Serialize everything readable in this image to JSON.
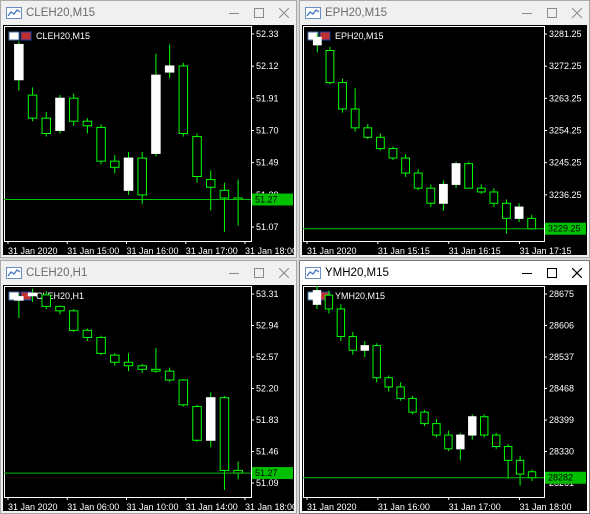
{
  "windows": [
    {
      "title": "CLEH20,M15",
      "active": false,
      "chart_label": "CLEH20,M15",
      "price_ticks": [
        "52.33",
        "52.12",
        "51.91",
        "51.70",
        "51.49",
        "51.28",
        "51.07"
      ],
      "current_price": "51.27",
      "time_ticks": [
        "31 Jan 2020",
        "31 Jan 15:00",
        "31 Jan 16:00",
        "31 Jan 17:00",
        "31 Jan 18:00"
      ]
    },
    {
      "title": "EPH20,M15",
      "active": false,
      "chart_label": "EPH20,M15",
      "price_ticks": [
        "3281.25",
        "3272.25",
        "3263.25",
        "3254.25",
        "3245.25",
        "3236.25",
        "3227.25"
      ],
      "current_price": "3229.25",
      "time_ticks": [
        "31 Jan 2020",
        "31 Jan 15:15",
        "31 Jan 16:15",
        "31 Jan 17:15"
      ]
    },
    {
      "title": "CLEH20,H1",
      "active": false,
      "chart_label": "CLEH20,H1",
      "price_ticks": [
        "53.31",
        "52.94",
        "52.57",
        "52.20",
        "51.83",
        "51.46",
        "51.09"
      ],
      "current_price": "51.27",
      "time_ticks": [
        "31 Jan 2020",
        "31 Jan 06:00",
        "31 Jan 10:00",
        "31 Jan 14:00",
        "31 Jan 18:00"
      ]
    },
    {
      "title": "YMH20,M15",
      "active": true,
      "chart_label": "YMH20,M15",
      "price_ticks": [
        "28675",
        "28606",
        "28537",
        "28468",
        "28399",
        "28330",
        "28261"
      ],
      "current_price": "28282",
      "time_ticks": [
        "31 Jan 2020",
        "31 Jan 16:00",
        "31 Jan 17:00",
        "31 Jan 18:00"
      ]
    }
  ],
  "colors": {
    "chart_bg": "#000000",
    "candle_up": "#ffffff",
    "candle_down": "#ffffff",
    "wick": "#00ff00",
    "axis_text": "#ffffff",
    "price_line": "#00c000",
    "price_tag": "#00c000",
    "frame": "#ffffff"
  },
  "chart_data": [
    {
      "type": "candlestick",
      "symbol": "CLEH20,M15",
      "ylim": [
        51.0,
        52.4
      ],
      "candles": [
        {
          "o": 52.05,
          "h": 52.3,
          "l": 51.98,
          "c": 52.28
        },
        {
          "o": 51.95,
          "h": 52.0,
          "l": 51.78,
          "c": 51.8
        },
        {
          "o": 51.8,
          "h": 51.84,
          "l": 51.68,
          "c": 51.7
        },
        {
          "o": 51.72,
          "h": 51.95,
          "l": 51.7,
          "c": 51.93
        },
        {
          "o": 51.93,
          "h": 51.96,
          "l": 51.75,
          "c": 51.78
        },
        {
          "o": 51.78,
          "h": 51.8,
          "l": 51.7,
          "c": 51.75
        },
        {
          "o": 51.74,
          "h": 51.76,
          "l": 51.5,
          "c": 51.52
        },
        {
          "o": 51.52,
          "h": 51.56,
          "l": 51.44,
          "c": 51.48
        },
        {
          "o": 51.33,
          "h": 51.58,
          "l": 51.3,
          "c": 51.54
        },
        {
          "o": 51.54,
          "h": 51.58,
          "l": 51.24,
          "c": 51.3
        },
        {
          "o": 51.57,
          "h": 52.22,
          "l": 51.55,
          "c": 52.08
        },
        {
          "o": 52.1,
          "h": 52.28,
          "l": 52.06,
          "c": 52.14
        },
        {
          "o": 52.14,
          "h": 52.16,
          "l": 51.68,
          "c": 51.7
        },
        {
          "o": 51.68,
          "h": 51.7,
          "l": 51.38,
          "c": 51.42
        },
        {
          "o": 51.4,
          "h": 51.46,
          "l": 51.2,
          "c": 51.35
        },
        {
          "o": 51.33,
          "h": 51.38,
          "l": 51.06,
          "c": 51.28
        },
        {
          "o": 51.28,
          "h": 51.4,
          "l": 51.1,
          "c": 51.27
        }
      ],
      "current_price": 51.27
    },
    {
      "type": "candlestick",
      "symbol": "EPH20,M15",
      "ylim": [
        3226.0,
        3283.0
      ],
      "candles": [
        {
          "o": 3278.0,
          "h": 3281.0,
          "l": 3276.0,
          "c": 3280.0
        },
        {
          "o": 3276.5,
          "h": 3277.5,
          "l": 3267.5,
          "c": 3268.0
        },
        {
          "o": 3268.0,
          "h": 3269.0,
          "l": 3260.0,
          "c": 3261.0
        },
        {
          "o": 3261.0,
          "h": 3266.5,
          "l": 3255.0,
          "c": 3256.0
        },
        {
          "o": 3256.0,
          "h": 3257.0,
          "l": 3253.0,
          "c": 3253.5
        },
        {
          "o": 3253.5,
          "h": 3254.5,
          "l": 3250.0,
          "c": 3250.5
        },
        {
          "o": 3250.5,
          "h": 3251.0,
          "l": 3247.5,
          "c": 3248.0
        },
        {
          "o": 3248.0,
          "h": 3249.0,
          "l": 3243.0,
          "c": 3244.0
        },
        {
          "o": 3244.0,
          "h": 3245.0,
          "l": 3239.5,
          "c": 3240.0
        },
        {
          "o": 3240.0,
          "h": 3241.0,
          "l": 3235.0,
          "c": 3236.0
        },
        {
          "o": 3236.0,
          "h": 3242.0,
          "l": 3234.0,
          "c": 3241.0
        },
        {
          "o": 3241.0,
          "h": 3247.0,
          "l": 3240.0,
          "c": 3246.5
        },
        {
          "o": 3246.5,
          "h": 3247.0,
          "l": 3240.0,
          "c": 3240.0
        },
        {
          "o": 3240.0,
          "h": 3241.0,
          "l": 3238.5,
          "c": 3239.0
        },
        {
          "o": 3239.0,
          "h": 3240.0,
          "l": 3235.0,
          "c": 3236.0
        },
        {
          "o": 3236.0,
          "h": 3237.0,
          "l": 3228.0,
          "c": 3232.0
        },
        {
          "o": 3232.0,
          "h": 3236.0,
          "l": 3231.0,
          "c": 3235.0
        },
        {
          "o": 3232.0,
          "h": 3233.0,
          "l": 3229.0,
          "c": 3229.25
        }
      ],
      "current_price": 3229.25
    },
    {
      "type": "candlestick",
      "symbol": "CLEH20,H1",
      "ylim": [
        51.0,
        53.38
      ],
      "candles": [
        {
          "o": 53.22,
          "h": 53.28,
          "l": 53.02,
          "c": 53.26
        },
        {
          "o": 53.27,
          "h": 53.35,
          "l": 53.2,
          "c": 53.3
        },
        {
          "o": 53.28,
          "h": 53.32,
          "l": 53.12,
          "c": 53.15
        },
        {
          "o": 53.15,
          "h": 53.16,
          "l": 53.06,
          "c": 53.1
        },
        {
          "o": 53.1,
          "h": 53.12,
          "l": 52.86,
          "c": 52.88
        },
        {
          "o": 52.88,
          "h": 52.9,
          "l": 52.76,
          "c": 52.8
        },
        {
          "o": 52.8,
          "h": 52.82,
          "l": 52.6,
          "c": 52.62
        },
        {
          "o": 52.6,
          "h": 52.62,
          "l": 52.48,
          "c": 52.52
        },
        {
          "o": 52.52,
          "h": 52.62,
          "l": 52.42,
          "c": 52.48
        },
        {
          "o": 52.48,
          "h": 52.5,
          "l": 52.4,
          "c": 52.44
        },
        {
          "o": 52.44,
          "h": 52.68,
          "l": 52.4,
          "c": 52.42
        },
        {
          "o": 52.42,
          "h": 52.46,
          "l": 52.3,
          "c": 52.32
        },
        {
          "o": 52.32,
          "h": 52.33,
          "l": 52.02,
          "c": 52.04
        },
        {
          "o": 52.02,
          "h": 52.04,
          "l": 51.62,
          "c": 51.64
        },
        {
          "o": 51.64,
          "h": 52.18,
          "l": 51.56,
          "c": 52.12
        },
        {
          "o": 52.12,
          "h": 52.14,
          "l": 51.08,
          "c": 51.3
        },
        {
          "o": 51.3,
          "h": 51.4,
          "l": 51.2,
          "c": 51.27
        }
      ],
      "current_price": 51.27
    },
    {
      "type": "candlestick",
      "symbol": "YMH20,M15",
      "ylim": [
        28240,
        28700
      ],
      "candles": [
        {
          "o": 28660,
          "h": 28700,
          "l": 28650,
          "c": 28690
        },
        {
          "o": 28680,
          "h": 28690,
          "l": 28640,
          "c": 28650
        },
        {
          "o": 28650,
          "h": 28660,
          "l": 28580,
          "c": 28590
        },
        {
          "o": 28590,
          "h": 28600,
          "l": 28550,
          "c": 28560
        },
        {
          "o": 28560,
          "h": 28580,
          "l": 28545,
          "c": 28570
        },
        {
          "o": 28570,
          "h": 28575,
          "l": 28490,
          "c": 28500
        },
        {
          "o": 28500,
          "h": 28505,
          "l": 28470,
          "c": 28480
        },
        {
          "o": 28480,
          "h": 28490,
          "l": 28450,
          "c": 28455
        },
        {
          "o": 28455,
          "h": 28460,
          "l": 28420,
          "c": 28425
        },
        {
          "o": 28425,
          "h": 28430,
          "l": 28395,
          "c": 28400
        },
        {
          "o": 28400,
          "h": 28410,
          "l": 28370,
          "c": 28375
        },
        {
          "o": 28375,
          "h": 28385,
          "l": 28340,
          "c": 28345
        },
        {
          "o": 28345,
          "h": 28380,
          "l": 28320,
          "c": 28375
        },
        {
          "o": 28375,
          "h": 28420,
          "l": 28365,
          "c": 28415
        },
        {
          "o": 28415,
          "h": 28420,
          "l": 28370,
          "c": 28375
        },
        {
          "o": 28375,
          "h": 28380,
          "l": 28345,
          "c": 28350
        },
        {
          "o": 28350,
          "h": 28355,
          "l": 28280,
          "c": 28320
        },
        {
          "o": 28320,
          "h": 28330,
          "l": 28265,
          "c": 28290
        },
        {
          "o": 28295,
          "h": 28300,
          "l": 28275,
          "c": 28282
        }
      ],
      "current_price": 28282
    }
  ]
}
